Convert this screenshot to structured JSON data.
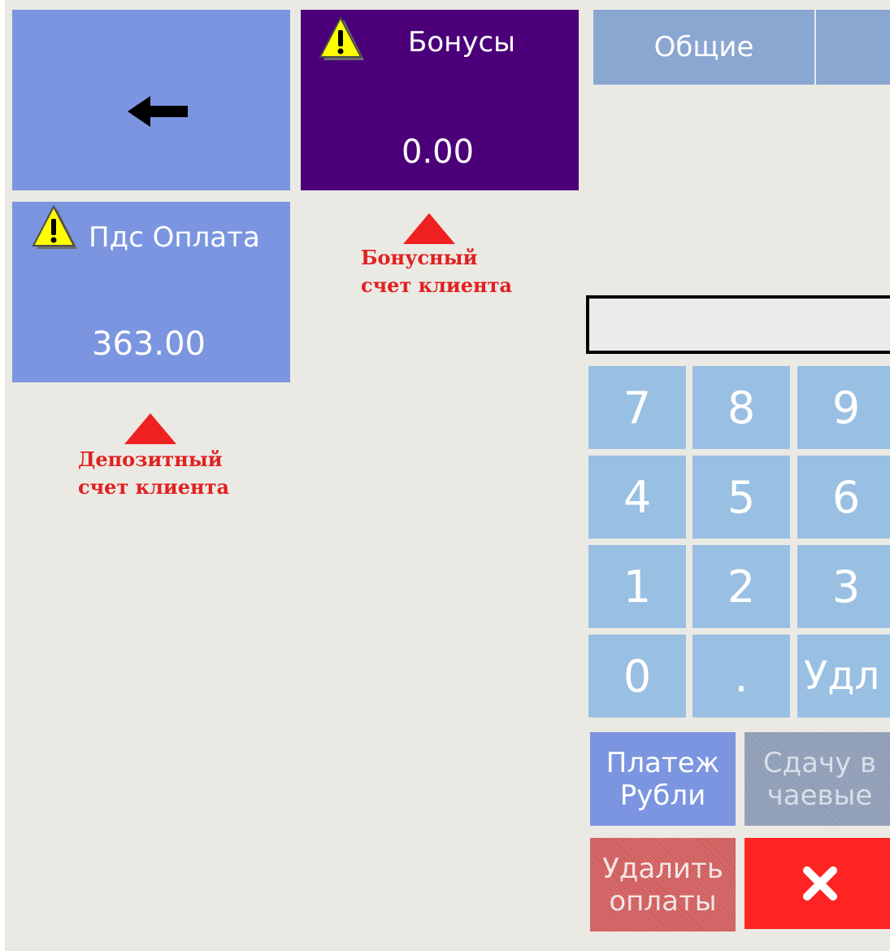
{
  "tiles": {
    "back": {
      "icon": "arrow-left-icon"
    },
    "bonus": {
      "label": "Бонусы",
      "value": "0.00",
      "icon": "warning-icon",
      "color": "#4b007a"
    },
    "pds": {
      "label": "Пдс Оплата",
      "value": "363.00",
      "icon": "warning-icon",
      "color": "#7b95e0"
    }
  },
  "annotations": {
    "bonus": {
      "line1": "Бонусный",
      "line2": "счет клиента"
    },
    "deposit": {
      "line1": "Депозитный",
      "line2": "счет клиента"
    }
  },
  "tabs": {
    "general": "Общие"
  },
  "keypad": {
    "k7": "7",
    "k8": "8",
    "k9": "9",
    "k4": "4",
    "k5": "5",
    "k6": "6",
    "k1": "1",
    "k2": "2",
    "k3": "3",
    "k0": "0",
    "kdot": ".",
    "kdel": "Удл"
  },
  "actions": {
    "pay_rub": {
      "line1": "Платеж",
      "line2": "Рубли"
    },
    "tip": {
      "line1": "Сдачу в",
      "line2": "чаевые"
    },
    "delete_payments": {
      "line1": "Удалить",
      "line2": "оплаты"
    },
    "cancel_icon": "close-icon"
  },
  "colors": {
    "tile_blue": "#7b95e0",
    "tile_purple": "#4b007a",
    "keypad": "#99bfe3",
    "tab": "#8aa7d2",
    "annotation_red": "#e12020",
    "cancel_red": "#ff2424"
  }
}
